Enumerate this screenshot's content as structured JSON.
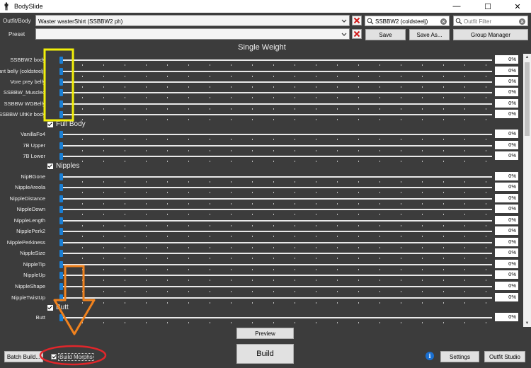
{
  "window": {
    "title": "BodySlide",
    "minimize": "—",
    "maximize": "☐",
    "close": "✕"
  },
  "top": {
    "outfit_label": "Outfit/Body",
    "outfit_value": "Waster wasterShirt (SSBBW2 ph)",
    "group_filter_value": "SSBBW2 (coldsteelj)",
    "outfit_filter_placeholder": "Outfit Filter",
    "preset_label": "Preset",
    "preset_value": "",
    "save_label": "Save",
    "save_as_label": "Save As...",
    "group_manager_label": "Group Manager"
  },
  "section_title": "Single Weight",
  "sliders_top": [
    {
      "name": "SSBBW2 body",
      "value": "0%"
    },
    {
      "name": "Giant belly (coldsteelj)",
      "value": "0%"
    },
    {
      "name": "Vore prey belly",
      "value": "0%"
    },
    {
      "name": "SSBBW_Muscled",
      "value": "0%"
    },
    {
      "name": "SSBBW WGBelly",
      "value": "0%"
    },
    {
      "name": "SSBBW UltKir body",
      "value": "0%"
    }
  ],
  "group_full_body": "Full Body",
  "sliders_full_body": [
    {
      "name": "VanillaFo4",
      "value": "0%"
    },
    {
      "name": "7B Upper",
      "value": "0%"
    },
    {
      "name": "7B Lower",
      "value": "0%"
    }
  ],
  "group_nipples": "Nipples",
  "sliders_nipples": [
    {
      "name": "NipBGone",
      "value": "0%"
    },
    {
      "name": "NippleAreola",
      "value": "0%"
    },
    {
      "name": "NippleDistance",
      "value": "0%"
    },
    {
      "name": "NippleDown",
      "value": "0%"
    },
    {
      "name": "NippleLength",
      "value": "0%"
    },
    {
      "name": "NipplePerk2",
      "value": "0%"
    },
    {
      "name": "NipplePerkiness",
      "value": "0%"
    },
    {
      "name": "NippleSize",
      "value": "0%"
    },
    {
      "name": "NippleTip",
      "value": "0%"
    },
    {
      "name": "NippleUp",
      "value": "0%"
    },
    {
      "name": "NippleShape",
      "value": "0%"
    },
    {
      "name": "NippleTwistUp",
      "value": "0%"
    }
  ],
  "group_butt": "Butt",
  "sliders_butt": [
    {
      "name": "Butt",
      "value": "0%"
    }
  ],
  "bottom": {
    "preview_label": "Preview",
    "build_label": "Build",
    "batch_build_label": "Batch Build...",
    "build_morphs_label": "Build Morphs",
    "info_glyph": "i",
    "settings_label": "Settings",
    "outfit_studio_label": "Outfit Studio"
  },
  "colors": {
    "background": "#3c3c3c",
    "slider_thumb": "#1a7fd4",
    "highlight_yellow": "#f2ef0a",
    "arrow_orange": "#f0821e",
    "circle_red": "#e0262b"
  }
}
